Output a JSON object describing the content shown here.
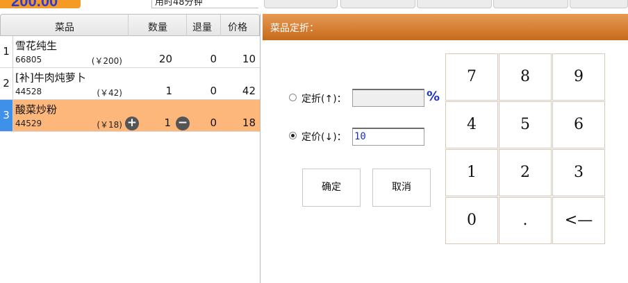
{
  "header": {
    "total": "200.00",
    "elapsed": "用时48分钟",
    "accent_color": "#f59a25",
    "total_color": "#2d3bd6"
  },
  "order_table": {
    "columns": {
      "dish": "菜品",
      "qty": "数量",
      "returned": "退量",
      "price": "价格"
    },
    "rows": [
      {
        "index": "1",
        "name": "雪花纯生",
        "code": "66805",
        "unit_price": "(￥200)",
        "qty": "20",
        "returned": "0",
        "price": "10"
      },
      {
        "index": "2",
        "name": "[补]牛肉炖萝卜",
        "code": "44528",
        "unit_price": "(￥42)",
        "qty": "1",
        "returned": "0",
        "price": "42"
      },
      {
        "index": "3",
        "name": "酸菜炒粉",
        "code": "44529",
        "unit_price": "(￥18)",
        "qty": "1",
        "returned": "0",
        "price": "18",
        "selected": true
      }
    ],
    "selected_row_color": "#fdb77a",
    "plus_icon": "plus-circle-icon",
    "minus_icon": "minus-circle-icon"
  },
  "discount": {
    "title": "菜品定折：",
    "option_percent": {
      "label": "定折(↑)：",
      "value": "",
      "suffix": "%",
      "checked": false
    },
    "option_price": {
      "label": "定价(↓)：",
      "value": "10",
      "checked": true
    },
    "confirm_label": "确定",
    "cancel_label": "取消",
    "title_bar_color": "#d67c2e"
  },
  "keypad": {
    "keys": [
      "7",
      "8",
      "9",
      "4",
      "5",
      "6",
      "1",
      "2",
      "3",
      "0",
      ".",
      "<—"
    ]
  }
}
